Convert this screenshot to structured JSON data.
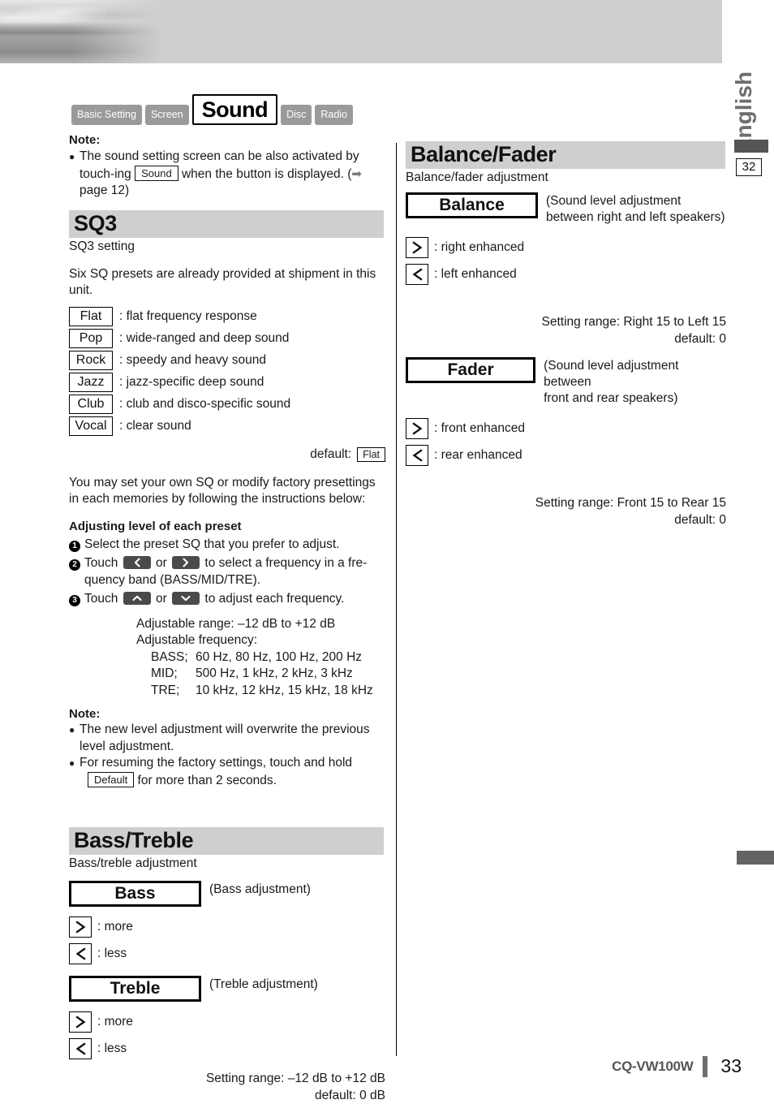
{
  "header": {
    "language_tab": "English",
    "page_marker": "32"
  },
  "tabs": [
    {
      "label": "Basic Setting",
      "active": false
    },
    {
      "label": "Screen",
      "active": false
    },
    {
      "label": "Sound",
      "active": true
    },
    {
      "label": "Disc",
      "active": false
    },
    {
      "label": "Radio",
      "active": false
    }
  ],
  "left": {
    "note_heading": "Note:",
    "note_text_a": "The sound setting screen can be also activated by touch-ing",
    "note_button": "Sound",
    "note_text_b": "when the button is displayed. (",
    "note_text_c": "page 12)",
    "sq3": {
      "title": "SQ3",
      "subtitle": "SQ3 setting",
      "intro": "Six SQ presets are already provided at shipment in this unit.",
      "presets": [
        {
          "name": "Flat",
          "desc": ": flat frequency response"
        },
        {
          "name": "Pop",
          "desc": ": wide-ranged and deep sound"
        },
        {
          "name": "Rock",
          "desc": ": speedy and heavy sound"
        },
        {
          "name": "Jazz",
          "desc": ": jazz-specific deep sound"
        },
        {
          "name": "Club",
          "desc": ": club and disco-specific sound"
        },
        {
          "name": "Vocal",
          "desc": ": clear sound"
        }
      ],
      "default_label": "default:",
      "default_value": "Flat",
      "custom_text": "You may set your own SQ or modify factory presettings in each memories by following the instructions below:",
      "adjust_heading": "Adjusting level of each preset",
      "step1_num": "1",
      "step1_text": "Select the preset SQ that you prefer to adjust.",
      "step2_num": "2",
      "step2_a": "Touch",
      "step2_or": "or",
      "step2_b": "to select a frequency in a fre-quency band (BASS/MID/TRE).",
      "step3_num": "3",
      "step3_a": "Touch",
      "step3_or": "or",
      "step3_b": "to adjust each frequency.",
      "adjustable_range": "Adjustable range: –12 dB to +12 dB",
      "adjustable_frequency": "Adjustable frequency:",
      "bands": [
        {
          "label": "BASS;",
          "values": "60 Hz, 80 Hz, 100 Hz, 200 Hz"
        },
        {
          "label": "MID;",
          "values": "500 Hz, 1 kHz, 2 kHz, 3 kHz"
        },
        {
          "label": "TRE;",
          "values": "10 kHz, 12 kHz, 15 kHz, 18 kHz"
        }
      ],
      "note2_heading": "Note:",
      "note2_item1": "The new level adjustment will overwrite the previous level adjustment.",
      "note2_item2_a": "For resuming the factory settings, touch and hold",
      "note2_button": "Default",
      "note2_item2_b": "for more than 2 seconds."
    },
    "bass_treble": {
      "title": "Bass/Treble",
      "subtitle": "Bass/treble adjustment",
      "bass_button": "Bass",
      "bass_note": "(Bass adjustment)",
      "bass_more": ": more",
      "bass_less": ": less",
      "treble_button": "Treble",
      "treble_note": "(Treble adjustment)",
      "treble_more": ": more",
      "treble_less": ": less",
      "range_line1": "Setting range: –12 dB to +12 dB",
      "range_line2": "default: 0 dB"
    }
  },
  "right": {
    "balance_fader": {
      "title": "Balance/Fader",
      "subtitle": "Balance/fader adjustment",
      "balance_button": "Balance",
      "balance_note_line1": "(Sound level adjustment",
      "balance_note_line2": "between right and left speakers)",
      "balance_right": ": right enhanced",
      "balance_left": ": left enhanced",
      "balance_range1": "Setting range: Right 15 to Left 15",
      "balance_range2": "default: 0",
      "fader_button": "Fader",
      "fader_note_line1": "(Sound level adjustment between",
      "fader_note_line2": "front and rear speakers)",
      "fader_front": ": front enhanced",
      "fader_rear": ": rear enhanced",
      "fader_range1": "Setting range: Front 15 to Rear 15",
      "fader_range2": "default: 0"
    }
  },
  "footer": {
    "model": "CQ-VW100W",
    "page_number": "33"
  },
  "icons": {
    "arrow_right": "➡",
    "chevron_right": "›",
    "chevron_left": "‹",
    "chevron_up": "˄",
    "chevron_down": "˅",
    "gt": ">",
    "lt": "<"
  },
  "colors": {
    "band_gray": "#cfcfcf",
    "tab_gray": "#9a9a9a",
    "key_dark": "#4a4a4a",
    "marker_dark": "#555555"
  }
}
